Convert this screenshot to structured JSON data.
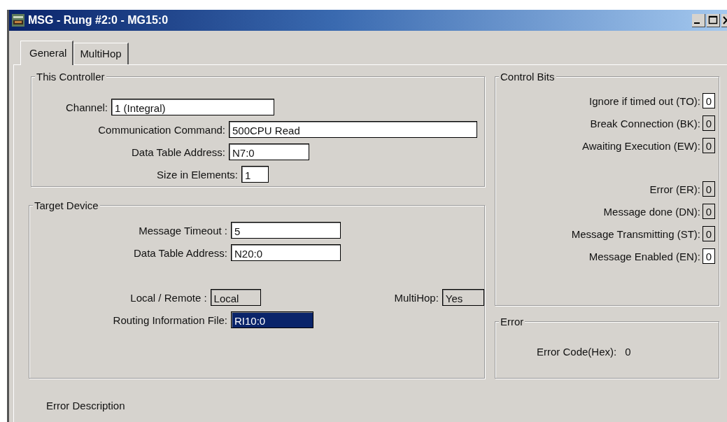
{
  "window": {
    "title": "MSG - Rung #2:0 - MG15:0"
  },
  "tabs": [
    {
      "label": "General",
      "selected": true
    },
    {
      "label": "MultiHop",
      "selected": false
    }
  ],
  "this_controller": {
    "title": "This Controller",
    "rows": [
      {
        "fields": [
          {
            "label": "Channel:",
            "value": "1 (Integral)",
            "kind": "text"
          }
        ]
      },
      {
        "fields": [
          {
            "label": "Communication Command:",
            "value": "500CPU Read",
            "kind": "text"
          }
        ]
      },
      {
        "fields": [
          {
            "label": "Data Table Address:",
            "value": "N7:0",
            "kind": "text"
          }
        ]
      },
      {
        "fields": [
          {
            "label": "Size in Elements:",
            "value": "1",
            "kind": "text"
          }
        ]
      }
    ]
  },
  "target_device": {
    "title": "Target Device",
    "rows": [
      {
        "fields": [
          {
            "label": "Message Timeout :",
            "value": "5",
            "kind": "text"
          }
        ]
      },
      {
        "fields": [
          {
            "label": "Data Table Address:",
            "value": "N20:0",
            "kind": "text"
          }
        ]
      },
      {
        "fields": [
          {
            "label": "Local / Remote :",
            "value": "Local",
            "kind": "readonly"
          },
          {
            "label": "MultiHop:",
            "value": "Yes",
            "kind": "readonly"
          }
        ]
      },
      {
        "fields": [
          {
            "label": "Routing Information File:",
            "value": "RI10:0",
            "kind": "selected"
          }
        ]
      }
    ]
  },
  "control_bits": {
    "title": "Control Bits",
    "groups": [
      [
        {
          "label": "Ignore if timed out (TO):",
          "value": "0",
          "editable": true
        },
        {
          "label": "Break Connection (BK):",
          "value": "0",
          "editable": false
        },
        {
          "label": "Awaiting Execution (EW):",
          "value": "0",
          "editable": false
        }
      ],
      [
        {
          "label": "Error (ER):",
          "value": "0",
          "editable": false
        },
        {
          "label": "Message done (DN):",
          "value": "0",
          "editable": false
        },
        {
          "label": "Message Transmitting (ST):",
          "value": "0",
          "editable": false
        },
        {
          "label": "Message Enabled (EN):",
          "value": "0",
          "editable": true
        }
      ]
    ]
  },
  "error": {
    "title": "Error",
    "label": "Error Code(Hex):",
    "value": "0"
  },
  "error_description": {
    "title": "Error Description"
  }
}
